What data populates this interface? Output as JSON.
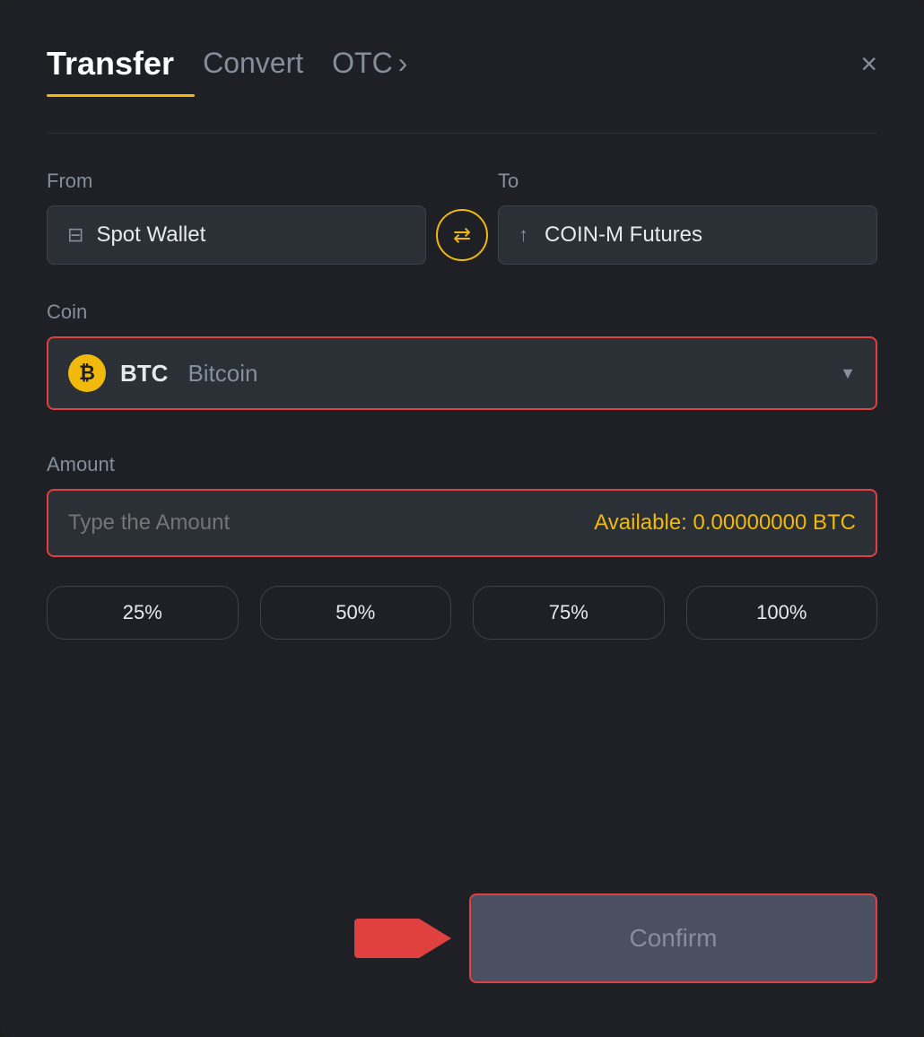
{
  "header": {
    "title": "Transfer",
    "nav_convert": "Convert",
    "nav_otc": "OTC",
    "close_label": "×"
  },
  "from": {
    "label": "From",
    "wallet": "Spot Wallet"
  },
  "to": {
    "label": "To",
    "wallet": "COIN-M Futures"
  },
  "coin": {
    "label": "Coin",
    "symbol": "BTC",
    "name": "Bitcoin"
  },
  "amount": {
    "label": "Amount",
    "placeholder": "Type the Amount",
    "available_label": "Available:",
    "available_value": "0.00000000",
    "available_unit": "BTC"
  },
  "percentages": [
    "25%",
    "50%",
    "75%",
    "100%"
  ],
  "confirm": {
    "label": "Confirm"
  }
}
